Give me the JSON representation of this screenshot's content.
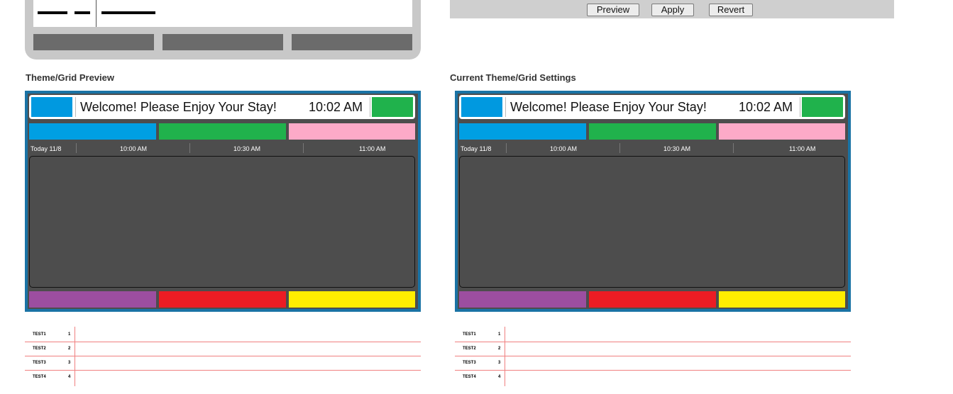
{
  "toolbar": {
    "preview_label": "Preview",
    "apply_label": "Apply",
    "revert_label": "Revert"
  },
  "sections": {
    "left_title": "Theme/Grid Preview",
    "right_title": "Current Theme/Grid Settings"
  },
  "panel": {
    "welcome_text": "Welcome! Please Enjoy Your Stay!",
    "time_text": "10:02 AM",
    "timeline": [
      "Today 11/8",
      "10:00 AM",
      "10:30 AM",
      "11:00 AM"
    ]
  },
  "colors": {
    "header_left": "#0099e0",
    "header_right": "#20b24c",
    "top_strip": [
      "#009fe3",
      "#20b24c",
      "#fdaac8"
    ],
    "bottom_strip": [
      "#9c4ea0",
      "#ec1c24",
      "#ffee00"
    ],
    "panel_border": "#1a73a5",
    "grid_bg": "#4d4d4d"
  },
  "tests": [
    {
      "name": "TEST1",
      "num": "1"
    },
    {
      "name": "TEST2",
      "num": "2"
    },
    {
      "name": "TEST3",
      "num": "3"
    },
    {
      "name": "TEST4",
      "num": "4"
    }
  ]
}
